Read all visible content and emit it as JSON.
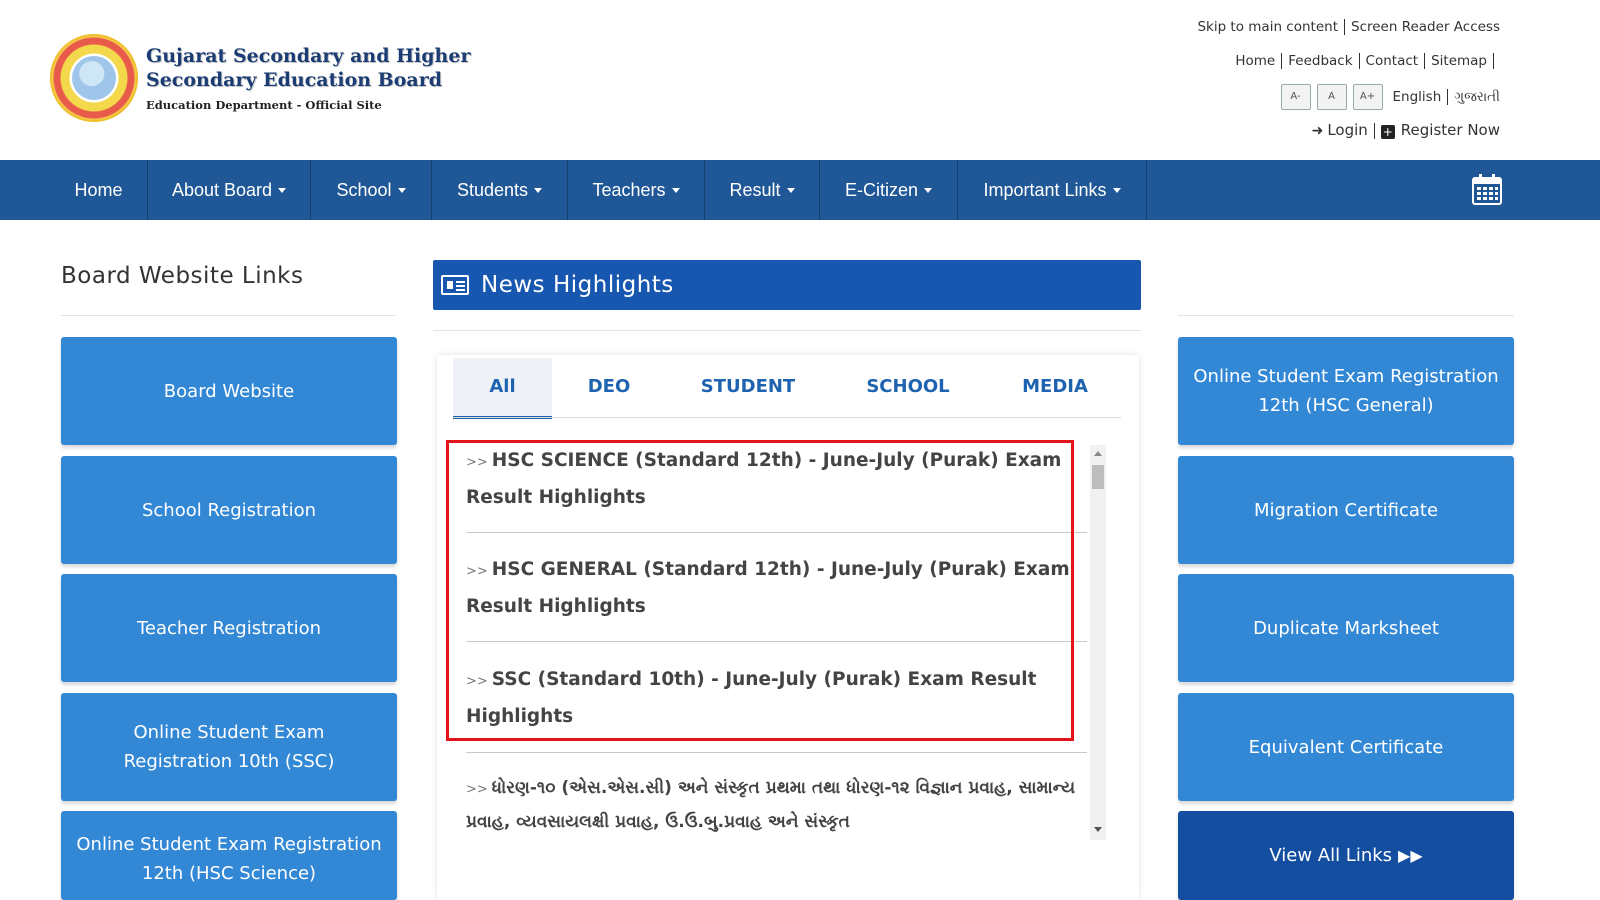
{
  "header": {
    "brand_title": "Gujarat Secondary and Higher Secondary Education Board",
    "brand_title_line1": "Gujarat Secondary and Higher",
    "brand_title_line2": "Secondary Education Board",
    "brand_subtitle": "Education Department - Official Site",
    "utility_links": {
      "skip": "Skip to main content",
      "screen_reader": "Screen Reader Access",
      "home": "Home",
      "feedback": "Feedback",
      "contact": "Contact",
      "sitemap": "Sitemap"
    },
    "font_controls": [
      "A-",
      "A",
      "A+"
    ],
    "languages": {
      "english": "English",
      "gujarati": "ગુજરાતી"
    },
    "account": {
      "login": "Login",
      "register": "Register Now"
    }
  },
  "nav": {
    "items": [
      {
        "label": "Home"
      },
      {
        "label": "About Board"
      },
      {
        "label": "School"
      },
      {
        "label": "Students"
      },
      {
        "label": "Teachers"
      },
      {
        "label": "Result"
      },
      {
        "label": "E-Citizen"
      },
      {
        "label": "Important Links"
      }
    ]
  },
  "left": {
    "title": "Board Website Links",
    "links": [
      "Board Website",
      "School Registration",
      "Teacher Registration",
      "Online Student Exam Registration 10th (SSC)",
      "Online Student Exam Registration 12th (HSC Science)"
    ]
  },
  "news": {
    "title": "News Highlights",
    "tabs": [
      "All",
      "DEO",
      "STUDENT",
      "SCHOOL",
      "MEDIA"
    ],
    "active_tab": "All",
    "items": [
      "HSC SCIENCE (Standard 12th) - June-July (Purak) Exam Result Highlights",
      "HSC GENERAL (Standard 12th) - June-July (Purak) Exam Result Highlights",
      "SSC (Standard 10th) - June-July (Purak) Exam Result Highlights",
      "ધોરણ-૧૦ (એસ.એસ.સી) અને સંસ્કૃત પ્રથમા તથા ધોરણ-૧૨ વિજ્ઞાન પ્રવાહ, સામાન્ય પ્રવાહ, વ્યવસાયલક્ષી પ્રવાહ, ઉ.ઉ.બુ.પ્રવાહ અને સંસ્કૃત"
    ],
    "arrow": ">>"
  },
  "right": {
    "links": [
      "Online Student Exam Registration 12th (HSC General)",
      "Migration Certificate",
      "Duplicate Marksheet",
      "Equivalent Certificate"
    ],
    "view_all": "View All Links"
  },
  "colors": {
    "nav": "#1f5797",
    "link_button": "#3388d6",
    "view_all_button": "#134ea0",
    "news_header": "#1757b0",
    "highlight_border": "#e3141b"
  }
}
